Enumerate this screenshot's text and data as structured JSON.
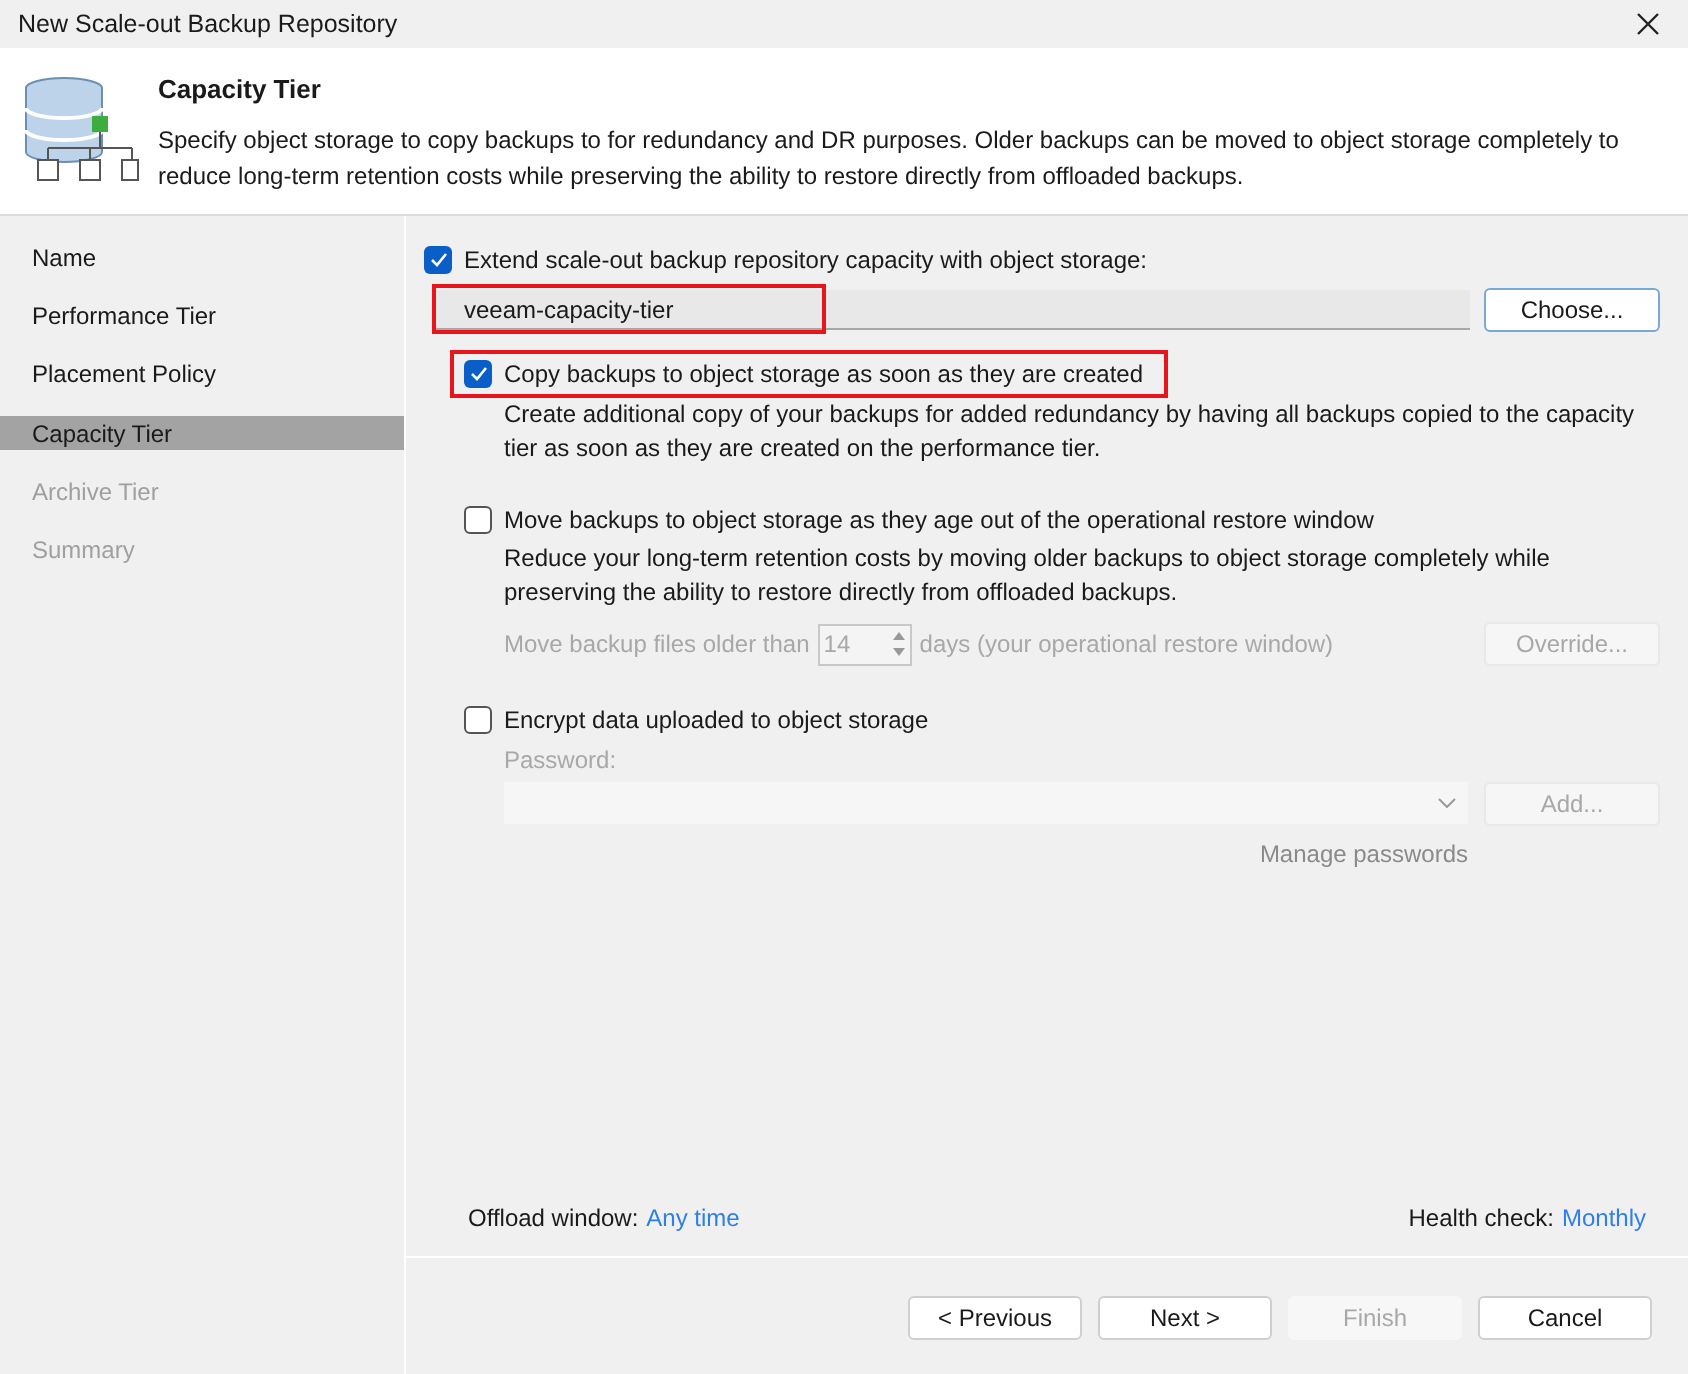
{
  "window": {
    "title": "New Scale-out Backup Repository"
  },
  "header": {
    "title": "Capacity Tier",
    "description": "Specify object storage to copy backups to for redundancy and DR purposes. Older backups can be moved to object storage completely to reduce long-term retention costs while preserving the ability to restore directly from offloaded backups."
  },
  "steps": [
    {
      "label": "Name",
      "selected": false,
      "disabled": false
    },
    {
      "label": "Performance Tier",
      "selected": false,
      "disabled": false
    },
    {
      "label": "Placement Policy",
      "selected": false,
      "disabled": false
    },
    {
      "label": "Capacity Tier",
      "selected": true,
      "disabled": false
    },
    {
      "label": "Archive Tier",
      "selected": false,
      "disabled": true
    },
    {
      "label": "Summary",
      "selected": false,
      "disabled": true
    }
  ],
  "extend": {
    "label": "Extend scale-out backup repository capacity with object storage:",
    "checked": true
  },
  "repository": {
    "value": "veeam-capacity-tier",
    "highlighted": true,
    "button": "Choose..."
  },
  "copy_option": {
    "label": "Copy backups to object storage as soon as they are created",
    "checked": true,
    "highlighted": true,
    "description": "Create additional copy of your backups for added redundancy by having all backups copied to the capacity tier as soon as they are created on the performance tier."
  },
  "move_option": {
    "label": "Move backups to object storage as they age out of the operational restore window",
    "checked": false,
    "description": "Reduce your long-term retention costs by moving older backups to object storage completely while preserving the ability to restore directly from offloaded backups.",
    "prefix": "Move backup files older than",
    "days": "14",
    "suffix": "days (your operational restore window)",
    "button": "Override...",
    "disabled": true
  },
  "encrypt_option": {
    "label": "Encrypt data uploaded to object storage",
    "checked": false,
    "password_label": "Password:",
    "button": "Add...",
    "link": "Manage passwords",
    "disabled": true
  },
  "footer": {
    "offload": {
      "label": "Offload window:",
      "value": "Any time"
    },
    "health": {
      "label": "Health check:",
      "value": "Monthly"
    }
  },
  "buttons": [
    {
      "label": "< Previous",
      "disabled": false
    },
    {
      "label": "Next >",
      "disabled": false
    },
    {
      "label": "Finish",
      "disabled": true
    },
    {
      "label": "Cancel",
      "disabled": false
    }
  ]
}
